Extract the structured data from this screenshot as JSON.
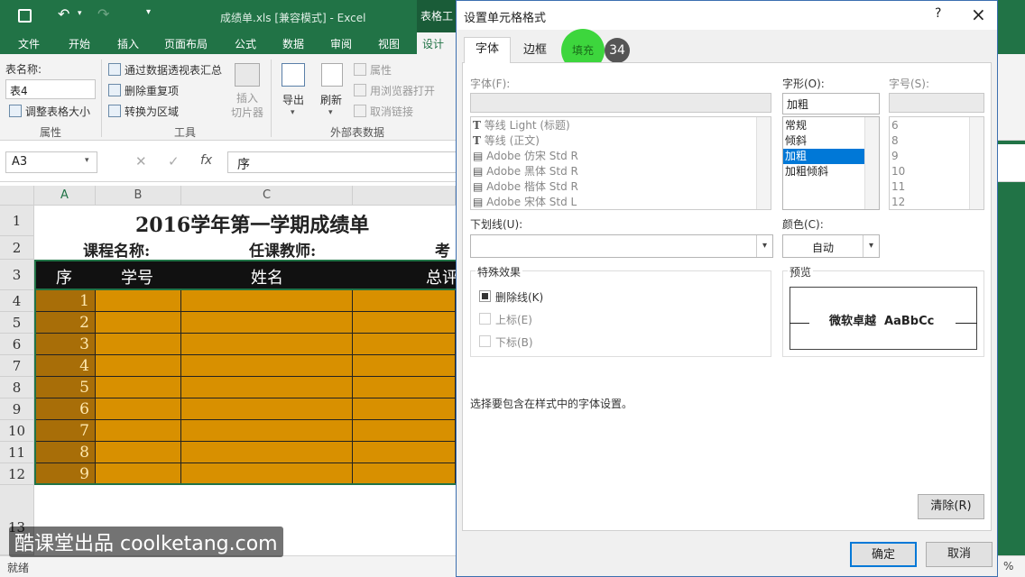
{
  "excel": {
    "title": "成绩单.xls  [兼容模式] - Excel",
    "context_tab": "表格工",
    "tabs": [
      "文件",
      "开始",
      "插入",
      "页面布局",
      "公式",
      "数据",
      "审阅",
      "视图",
      "设计"
    ],
    "ribbon": {
      "table_name_label": "表名称:",
      "table_name_value": "表4",
      "resize_table": "调整表格大小",
      "group_properties": "属性",
      "pivot_summary": "通过数据透视表汇总",
      "remove_duplicates": "删除重复项",
      "convert_to_range": "转换为区域",
      "insert_slicer_1": "插入",
      "insert_slicer_2": "切片器",
      "group_tools": "工具",
      "export": "导出",
      "refresh": "刷新",
      "properties": "属性",
      "open_in_browser": "用浏览器打开",
      "unlink": "取消链接",
      "group_external": "外部表数据"
    },
    "name_box": "A3",
    "formula_value": "序",
    "columns": [
      "A",
      "B",
      "C"
    ],
    "sheet": {
      "title": "2016学年第一学期成绩单",
      "course_label": "课程名称:",
      "teacher_label": "任课教师:",
      "exam_label": "考",
      "headers": [
        "序",
        "学号",
        "姓名",
        "总评"
      ],
      "row_numbers": [
        "1",
        "2",
        "3",
        "4",
        "5",
        "6",
        "7",
        "8",
        "9",
        "10",
        "11",
        "12",
        "13"
      ],
      "seq": [
        "1",
        "2",
        "3",
        "4",
        "5",
        "6",
        "7",
        "8",
        "9"
      ]
    },
    "status": "就绪",
    "zoom_fragment": "%",
    "fill_color": "#d89000",
    "seq_color": "#a86e08"
  },
  "dialog": {
    "title": "设置单元格格式",
    "help": "?",
    "close": "×",
    "tabs": [
      "字体",
      "边框",
      "填充"
    ],
    "step_badge": "34",
    "font_label": "字体(F):",
    "fonts": [
      "等线 Light (标题)",
      "等线 (正文)",
      "Adobe 仿宋 Std R",
      "Adobe 黑体 Std R",
      "Adobe 楷体 Std R",
      "Adobe 宋体 Std L"
    ],
    "style_label": "字形(O):",
    "style_value": "加粗",
    "styles": [
      "常规",
      "倾斜",
      "加粗",
      "加粗倾斜"
    ],
    "size_label": "字号(S):",
    "sizes": [
      "6",
      "8",
      "9",
      "10",
      "11",
      "12"
    ],
    "underline_label": "下划线(U):",
    "color_label": "颜色(C):",
    "color_value": "自动",
    "effects_label": "特殊效果",
    "strike": "删除线(K)",
    "superscript": "上标(E)",
    "subscript": "下标(B)",
    "preview_label": "预览",
    "preview_text": "微软卓越  AaBbCc",
    "hint": "选择要包含在样式中的字体设置。",
    "clear": "清除(R)",
    "ok": "确定",
    "cancel": "取消",
    "accent": "#3dd63d"
  },
  "watermark": "酷课堂出品 coolketang.com"
}
